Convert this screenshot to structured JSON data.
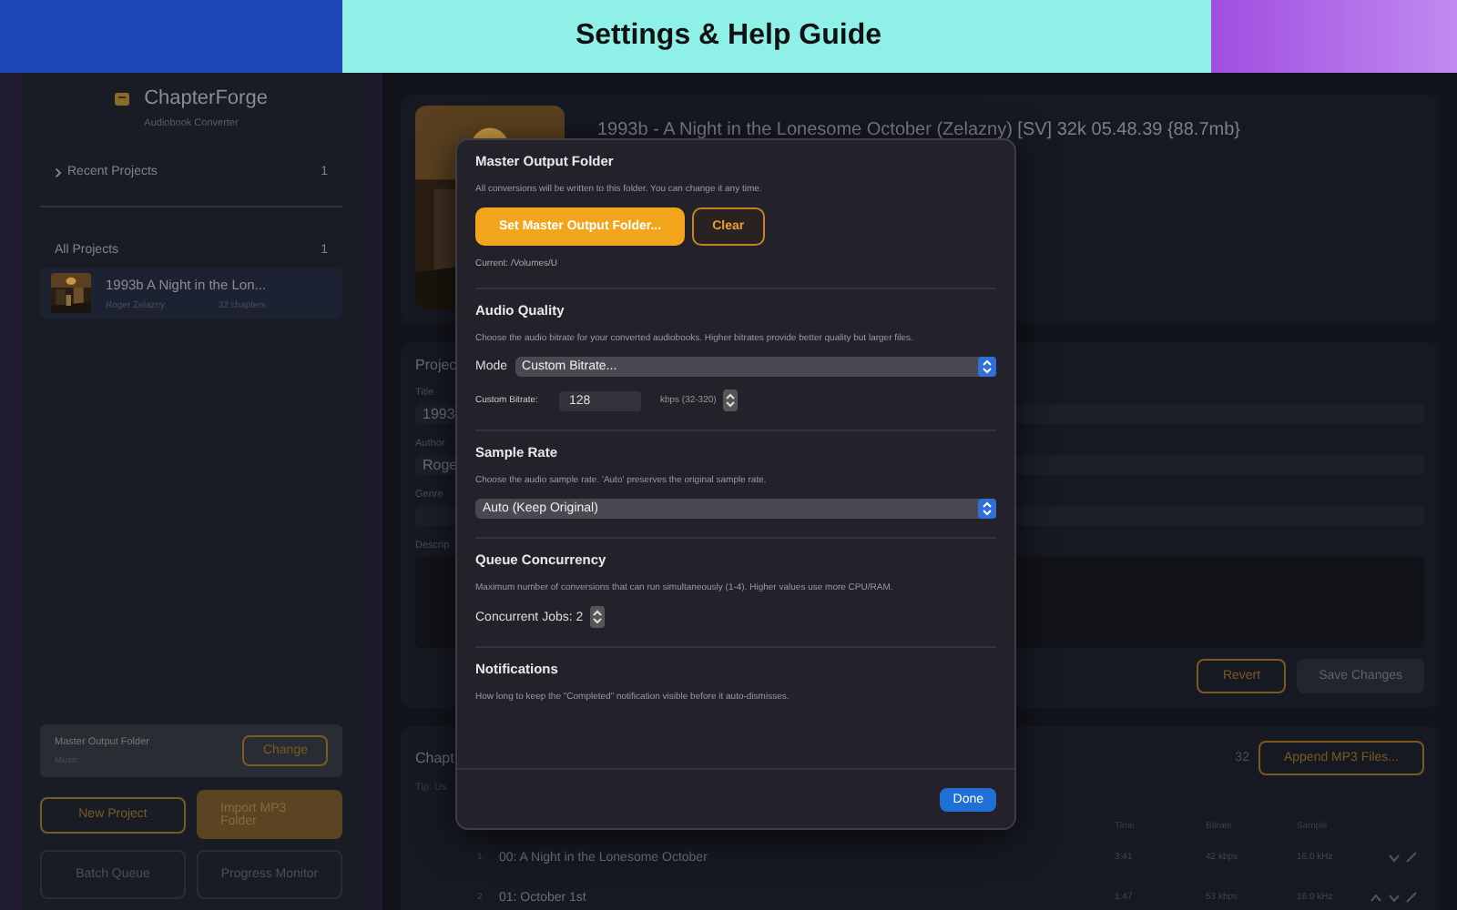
{
  "banner": {
    "title": "Settings & Help Guide"
  },
  "sidebar": {
    "app_name": "ChapterForge",
    "subtitle": "Audiobook Converter",
    "sections": [
      {
        "label": "Recent Projects",
        "count": "1",
        "expanded": false
      },
      {
        "label": "All Projects",
        "count": "1"
      }
    ],
    "projects": [
      {
        "title": "1993b   A Night in the Lon...",
        "author": "Roger Zelazny",
        "chapters": "32 chapters",
        "selected": true
      }
    ],
    "output_folder": {
      "label": "Master Output Folder",
      "value": "Music",
      "button": "Change"
    },
    "buttons": [
      {
        "label": "New Project",
        "kind": "outline"
      },
      {
        "label": "Import MP3 Folder",
        "kind": "filled"
      },
      {
        "label": "Batch Queue",
        "kind": "muted"
      },
      {
        "label": "Progress Monitor",
        "kind": "muted"
      }
    ]
  },
  "header": {
    "title": "1993b - A Night in the Lonesome October (Zelazny) [SV] 32k 05.48.39 {88.7mb}"
  },
  "project_panel": {
    "title": "Projec",
    "fields": [
      {
        "label": "Title",
        "value": "1993"
      },
      {
        "label": "Author",
        "value": "Roge"
      },
      {
        "label": "Genre"
      }
    ],
    "description_label": "Descrip",
    "revert": "Revert",
    "save": "Save Changes",
    "save_disabled": true
  },
  "chapters_panel": {
    "title": "Chapt",
    "tip": "Tip: Us",
    "count": "32",
    "append": "Append MP3 Files...",
    "columns": [
      "Time",
      "Bitrate",
      "Sample"
    ],
    "rows": [
      {
        "index": "1",
        "name": "00: A Night in the Lonesome October",
        "time": "3:41",
        "bitrate": "42 kbps",
        "sample": "16.0 kHz",
        "can_up": false,
        "can_down": true
      },
      {
        "index": "2",
        "name": "01: October 1st",
        "time": "1:47",
        "bitrate": "53 kbps",
        "sample": "16.0 kHz",
        "can_up": true,
        "can_down": true
      }
    ]
  },
  "modal": {
    "sections": [
      {
        "kind": "folder",
        "title": "Master Output Folder",
        "description": "All conversions will be written to this folder. You can change it any time.",
        "primary": "Set Master Output Folder...",
        "secondary": "Clear",
        "current": "Current: /Volumes/U"
      },
      {
        "kind": "bitrate",
        "title": "Audio Quality",
        "description": "Choose the audio bitrate for your converted audiobooks. Higher bitrates provide better quality but larger files.",
        "select_label": "Mode",
        "select_value": "Custom Bitrate...",
        "field_label": "Custom Bitrate:",
        "field_value": "128",
        "hint": "kbps (32-320)"
      },
      {
        "kind": "select",
        "title": "Sample Rate",
        "description": "Choose the audio sample rate. 'Auto' preserves the original sample rate.",
        "select_value": "Auto (Keep Original)"
      },
      {
        "kind": "stepper",
        "title": "Queue Concurrency",
        "description": "Maximum number of conversions that can run simultaneously (1-4). Higher values use more CPU/RAM.",
        "stepper_label": "Concurrent Jobs: 2"
      },
      {
        "kind": "text",
        "title": "Notifications",
        "description": "How long to keep the \"Completed\" notification visible before it auto-dismisses."
      }
    ],
    "done": "Done"
  }
}
